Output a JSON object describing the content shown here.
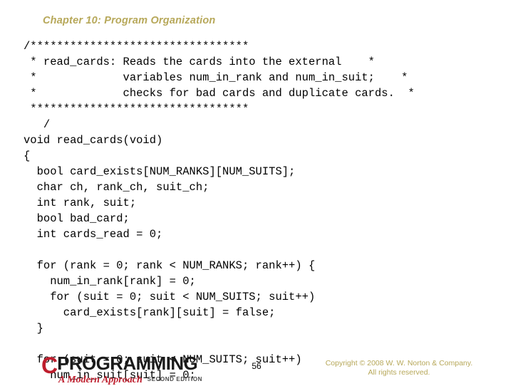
{
  "slide": {
    "chapter_title": "Chapter 10: Program Organization",
    "page_number": "56",
    "background_color": "#ffffff",
    "title_color": "#b7a85a"
  },
  "code": {
    "language": "c",
    "lines": [
      "/*********************************",
      " * read_cards: Reads the cards into the external    *",
      " *             variables num_in_rank and num_in_suit;    *",
      " *             checks for bad cards and duplicate cards.  *",
      " *********************************",
      "   /",
      "void read_cards(void)",
      "{",
      "  bool card_exists[NUM_RANKS][NUM_SUITS];",
      "  char ch, rank_ch, suit_ch;",
      "  int rank, suit;",
      "  bool bad_card;",
      "  int cards_read = 0;",
      "",
      "  for (rank = 0; rank < NUM_RANKS; rank++) {",
      "    num_in_rank[rank] = 0;",
      "    for (suit = 0; suit < NUM_SUITS; suit++)",
      "      card_exists[rank][suit] = false;",
      "  }",
      "",
      "  for (suit = 0; suit < NUM_SUITS; suit++)",
      "    num_in_suit[suit] = 0;"
    ]
  },
  "footer": {
    "logo": {
      "letter": "C",
      "word": "PROGRAMMING",
      "tagline": "A Modern Approach",
      "edition": "SECOND EDITION",
      "accent_color": "#be1e2d"
    },
    "copyright_line1": "Copyright © 2008 W. W. Norton & Company.",
    "copyright_line2": "All rights reserved.",
    "copyright_color": "#b7a85a"
  }
}
